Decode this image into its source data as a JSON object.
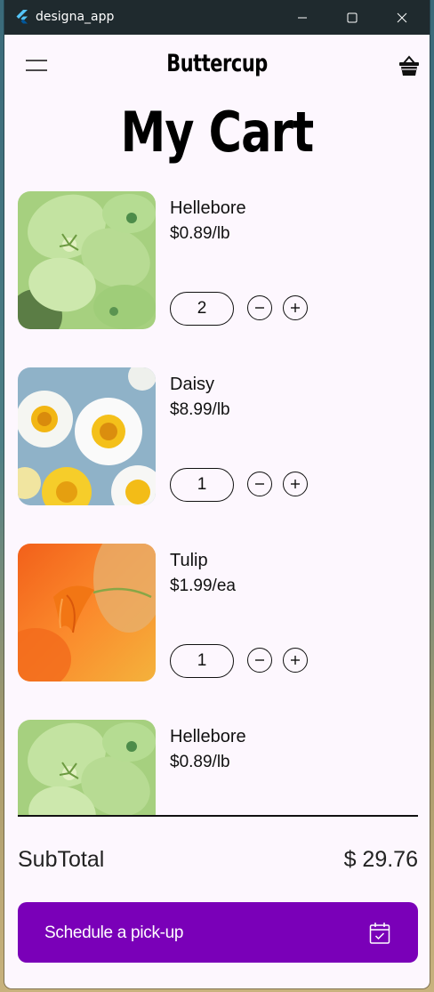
{
  "window": {
    "title": "designa_app"
  },
  "app_bar": {
    "brand": "Buttercup",
    "menu_icon": "hamburger-menu-icon",
    "cart_icon": "shopping-basket-icon"
  },
  "page": {
    "title": "My Cart"
  },
  "cart": {
    "items": [
      {
        "name": "Hellebore",
        "price": "$0.89/lb",
        "quantity": "2",
        "image": "hellebore-flower"
      },
      {
        "name": "Daisy",
        "price": "$8.99/lb",
        "quantity": "1",
        "image": "daisy-flowers"
      },
      {
        "name": "Tulip",
        "price": "$1.99/ea",
        "quantity": "1",
        "image": "orange-tulip"
      },
      {
        "name": "Hellebore",
        "price": "$0.89/lb",
        "quantity": "",
        "image": "hellebore-flower"
      }
    ]
  },
  "summary": {
    "subtotal_label": "SubTotal",
    "subtotal_value": "$ 29.76"
  },
  "actions": {
    "schedule_label": "Schedule a pick-up",
    "schedule_icon": "calendar-check-icon"
  },
  "colors": {
    "accent": "#7a00b8",
    "background": "#fdf7fe",
    "titlebar": "#1f2a2e"
  }
}
